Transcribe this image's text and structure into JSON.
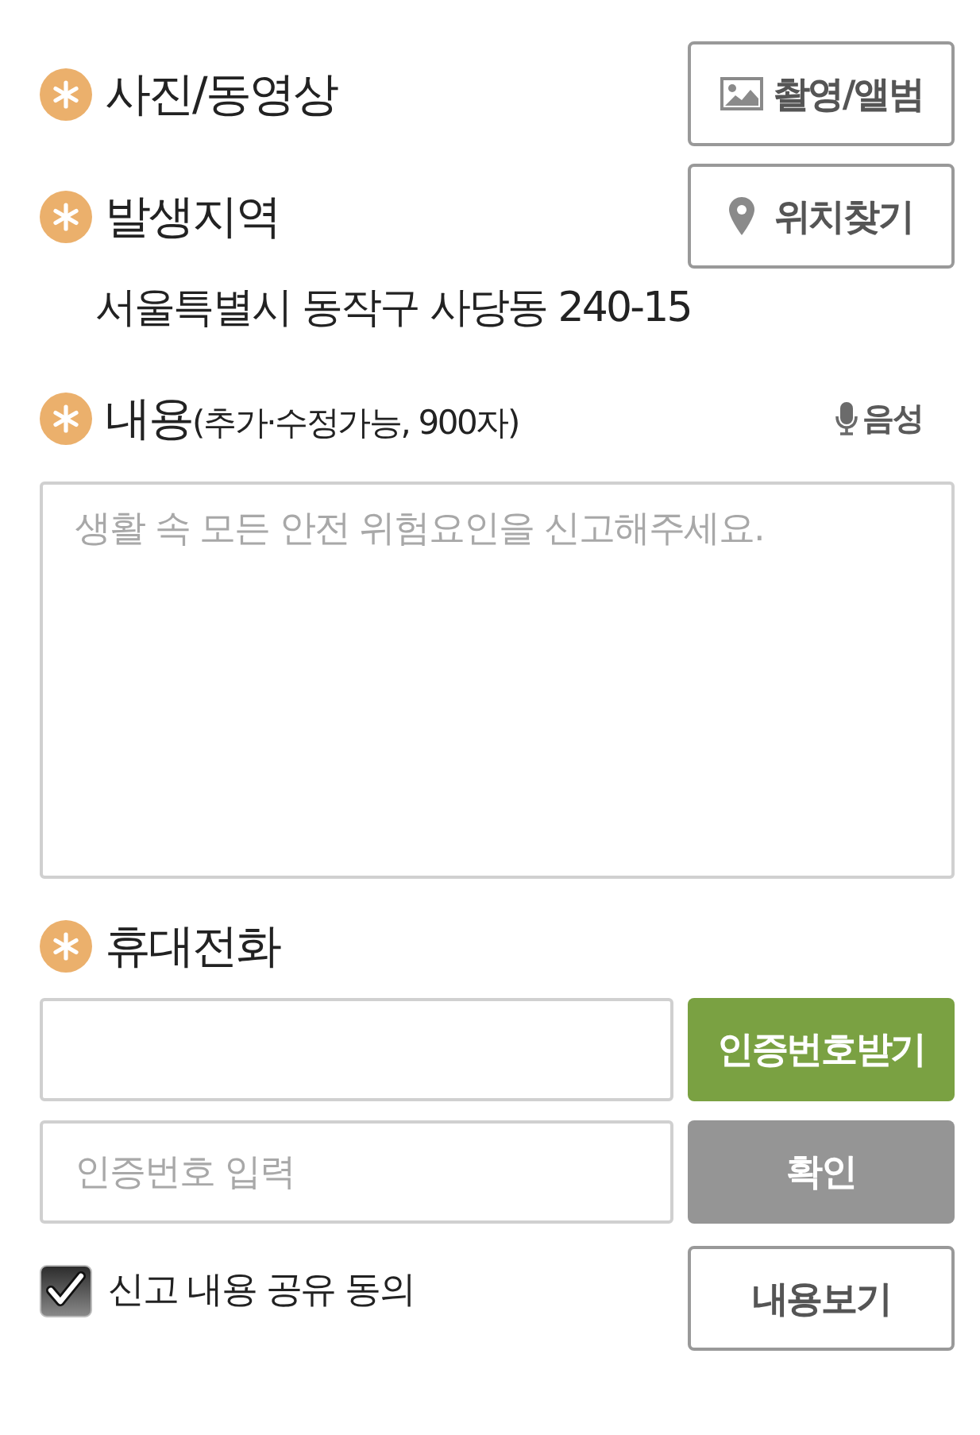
{
  "photo": {
    "label": "사진/동영상",
    "required": true,
    "button": {
      "label": "촬영/앨범"
    }
  },
  "location": {
    "label": "발생지역",
    "required": true,
    "button": {
      "label": "위치찾기"
    },
    "address": "서울특별시 동작구 사당동 240-15"
  },
  "content": {
    "label": "내용",
    "note": "(추가·수정가능, 900자)",
    "required": true,
    "voice_button": {
      "label": "음성"
    },
    "textarea": {
      "placeholder": "생활 속 모든 안전 위험요인을 신고해주세요."
    }
  },
  "phone": {
    "label": "휴대전화",
    "required": true,
    "rows": [
      {
        "button": {
          "label": "인증번호받기",
          "kind": "primary"
        }
      },
      {
        "placeholder": "인증번호 입력",
        "button": {
          "label": "확인",
          "kind": "muted"
        }
      }
    ]
  },
  "agreement": {
    "label": "신고 내용 공유 동의",
    "checked": true,
    "button": {
      "label": "내용보기"
    }
  }
}
